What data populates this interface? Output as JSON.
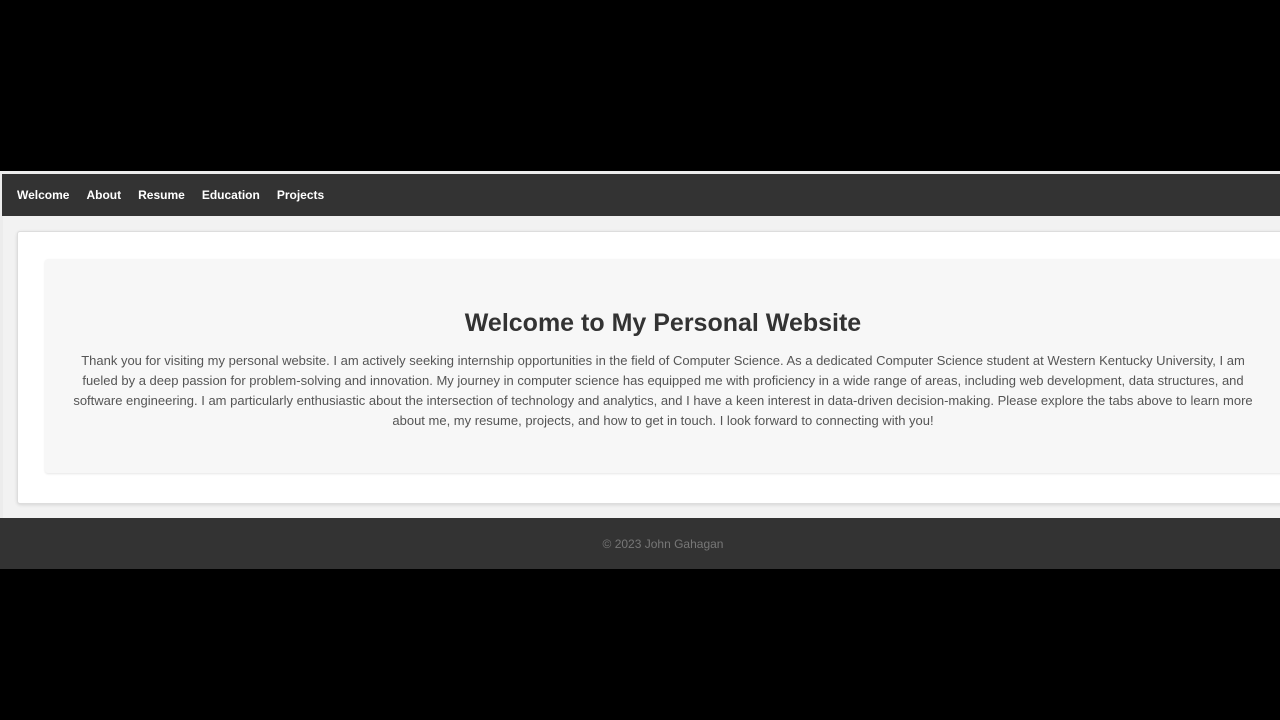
{
  "nav": {
    "items": [
      {
        "label": "Welcome"
      },
      {
        "label": "About"
      },
      {
        "label": "Resume"
      },
      {
        "label": "Education"
      },
      {
        "label": "Projects"
      }
    ]
  },
  "main": {
    "title": "Welcome to My Personal Website",
    "intro": "Thank you for visiting my personal website. I am actively seeking internship opportunities in the field of Computer Science. As a dedicated Computer Science student at Western Kentucky University, I am fueled by a deep passion for problem-solving and innovation. My journey in computer science has equipped me with proficiency in a wide range of areas, including web development, data structures, and software engineering. I am particularly enthusiastic about the intersection of technology and analytics, and I have a keen interest in data-driven decision-making. Please explore the tabs above to learn more about me, my resume, projects, and how to get in touch. I look forward to connecting with you!"
  },
  "footer": {
    "copyright": "© 2023 John Gahagan"
  },
  "colors": {
    "navbar_bg": "#333333",
    "nav_text": "#ffffff",
    "page_bg": "#f2f2f2",
    "card_bg": "#ffffff",
    "panel_bg": "#f7f7f7",
    "heading_text": "#333333",
    "body_text": "#555555",
    "footer_bg": "#333333",
    "footer_text": "#777777"
  }
}
